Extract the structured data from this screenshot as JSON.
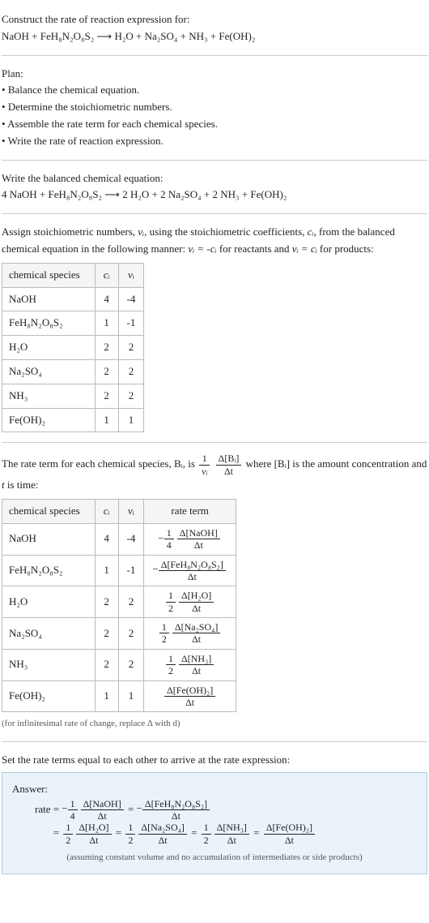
{
  "s1": {
    "prompt": "Construct the rate of reaction expression for:",
    "equation_l": "NaOH + FeH₈N₂O₈S₂",
    "arrow": "⟶",
    "equation_r": "H₂O + Na₂SO₄ + NH₃ + Fe(OH)₂"
  },
  "plan": {
    "title": "Plan:",
    "b1": "Balance the chemical equation.",
    "b2": "Determine the stoichiometric numbers.",
    "b3": "Assemble the rate term for each chemical species.",
    "b4": "Write the rate of reaction expression."
  },
  "balanced": {
    "title": "Write the balanced chemical equation:",
    "lhs": "4 NaOH + FeH₈N₂O₈S₂",
    "arrow": "⟶",
    "rhs": "2 H₂O + 2 Na₂SO₄ + 2 NH₃ + Fe(OH)₂"
  },
  "stoich": {
    "intro_a": "Assign stoichiometric numbers, ",
    "nu": "νᵢ",
    "intro_b": ", using the stoichiometric coefficients, ",
    "ci": "cᵢ",
    "intro_c": ", from the balanced chemical equation in the following manner: ",
    "rel1": "νᵢ = -cᵢ",
    "intro_d": " for reactants and ",
    "rel2": "νᵢ = cᵢ",
    "intro_e": " for products:",
    "h1": "chemical species",
    "h2": "cᵢ",
    "h3": "νᵢ",
    "rows": [
      {
        "sp": "NaOH",
        "c": "4",
        "n": "-4"
      },
      {
        "sp": "FeH₈N₂O₈S₂",
        "c": "1",
        "n": "-1"
      },
      {
        "sp": "H₂O",
        "c": "2",
        "n": "2"
      },
      {
        "sp": "Na₂SO₄",
        "c": "2",
        "n": "2"
      },
      {
        "sp": "NH₃",
        "c": "2",
        "n": "2"
      },
      {
        "sp": "Fe(OH)₂",
        "c": "1",
        "n": "1"
      }
    ]
  },
  "rate": {
    "intro_a": "The rate term for each chemical species, Bᵢ, is ",
    "f_num_l": "1",
    "f_den_l": "νᵢ",
    "f_num_r": "Δ[Bᵢ]",
    "f_den_r": "Δt",
    "intro_b": " where [Bᵢ] is the amount concentration and ",
    "intro_c": "t",
    "intro_d": " is time:",
    "h1": "chemical species",
    "h2": "cᵢ",
    "h3": "νᵢ",
    "h4": "rate term",
    "note": "(for infinitesimal rate of change, replace Δ with d)"
  },
  "final": {
    "title": "Set the rate terms equal to each other to arrive at the rate expression:",
    "ans": "Answer:",
    "rate_lbl": "rate = ",
    "eq": " = ",
    "assume": "(assuming constant volume and no accumulation of intermediates or side products)"
  }
}
